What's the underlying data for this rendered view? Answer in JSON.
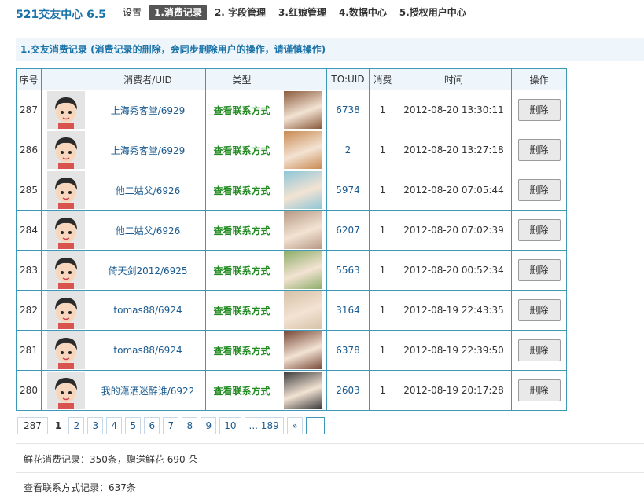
{
  "app": {
    "brand": "521交友中心 6.5"
  },
  "nav": {
    "items": [
      {
        "label": "设置"
      },
      {
        "label": "1.消费记录",
        "active": true
      },
      {
        "label": "2. 字段管理"
      },
      {
        "label": "3.红娘管理"
      },
      {
        "label": "4.数据中心"
      },
      {
        "label": "5.授权用户中心"
      }
    ]
  },
  "section": {
    "title": "1.交友消费记录 (消费记录的删除，会同步删除用户的操作，请谨慎操作)"
  },
  "table": {
    "headers": {
      "no": "序号",
      "avatar": "",
      "consumer": "消费者/UID",
      "type": "类型",
      "photo": "",
      "to_uid": "TO:UID",
      "spend": "消费",
      "time": "时间",
      "action": "操作"
    },
    "rows": [
      {
        "no": "287",
        "consumer": "上海秀客堂/6929",
        "type": "查看联系方式",
        "to_uid": "6738",
        "spend": "1",
        "time": "2012-08-20 13:30:11",
        "action": "删除",
        "photo_color": "#8a5a3c"
      },
      {
        "no": "286",
        "consumer": "上海秀客堂/6929",
        "type": "查看联系方式",
        "to_uid": "2",
        "spend": "1",
        "time": "2012-08-20 13:27:18",
        "action": "删除",
        "photo_color": "#c98a52"
      },
      {
        "no": "285",
        "consumer": "他二姑父/6926",
        "type": "查看联系方式",
        "to_uid": "5974",
        "spend": "1",
        "time": "2012-08-20 07:05:44",
        "action": "删除",
        "photo_color": "#8fc6d8"
      },
      {
        "no": "284",
        "consumer": "他二姑父/6926",
        "type": "查看联系方式",
        "to_uid": "6207",
        "spend": "1",
        "time": "2012-08-20 07:02:39",
        "action": "删除",
        "photo_color": "#b79a86"
      },
      {
        "no": "283",
        "consumer": "倚天剑2012/6925",
        "type": "查看联系方式",
        "to_uid": "5563",
        "spend": "1",
        "time": "2012-08-20 00:52:34",
        "action": "删除",
        "photo_color": "#8fae6a"
      },
      {
        "no": "282",
        "consumer": "tomas88/6924",
        "type": "查看联系方式",
        "to_uid": "3164",
        "spend": "1",
        "time": "2012-08-19 22:43:35",
        "action": "删除",
        "photo_color": "#d6c2a8"
      },
      {
        "no": "281",
        "consumer": "tomas88/6924",
        "type": "查看联系方式",
        "to_uid": "6378",
        "spend": "1",
        "time": "2012-08-19 22:39:50",
        "action": "删除",
        "photo_color": "#7a4a3a"
      },
      {
        "no": "280",
        "consumer": "我的潇洒迷醉谁/6922",
        "type": "查看联系方式",
        "to_uid": "2603",
        "spend": "1",
        "time": "2012-08-19 20:17:28",
        "action": "删除",
        "photo_color": "#3a3a3a"
      }
    ]
  },
  "pager": {
    "total": "287",
    "current": "1",
    "pages": [
      "2",
      "3",
      "4",
      "5",
      "6",
      "7",
      "8",
      "9",
      "10",
      "... 189",
      "»"
    ]
  },
  "stats": {
    "flowers": "鲜花消费记录：350条，赠送鲜花 690 朵",
    "contacts": "查看联系方式记录：637条"
  },
  "colors": {
    "accent": "#1a73a8",
    "border": "#3e99b8",
    "type_green": "#228b22"
  }
}
